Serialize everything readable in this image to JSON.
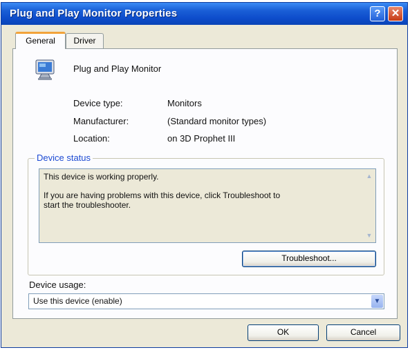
{
  "window": {
    "title": "Plug and Play Monitor Properties",
    "help_glyph": "?",
    "close_glyph": "✕"
  },
  "tabs": [
    {
      "label": "General",
      "active": true
    },
    {
      "label": "Driver",
      "active": false
    }
  ],
  "general": {
    "device_name": "Plug and Play Monitor",
    "device_icon": "monitor-icon",
    "properties": [
      {
        "label": "Device type:",
        "value": "Monitors"
      },
      {
        "label": "Manufacturer:",
        "value": "(Standard monitor types)"
      },
      {
        "label": "Location:",
        "value": "on 3D Prophet III"
      }
    ],
    "status_group": {
      "legend": "Device status",
      "line1": "This device is working properly.",
      "line2": "If you are having problems with this device, click Troubleshoot to",
      "line3": "start the troubleshooter.",
      "troubleshoot_label": "Troubleshoot..."
    },
    "usage": {
      "label": "Device usage:",
      "selected": "Use this device (enable)"
    }
  },
  "footer": {
    "ok_label": "OK",
    "cancel_label": "Cancel"
  },
  "colors": {
    "titlebar": "#0d4ccb",
    "accent_tab": "#f2a33a",
    "group_legend": "#1c4ad3",
    "close_button": "#c63a14"
  }
}
